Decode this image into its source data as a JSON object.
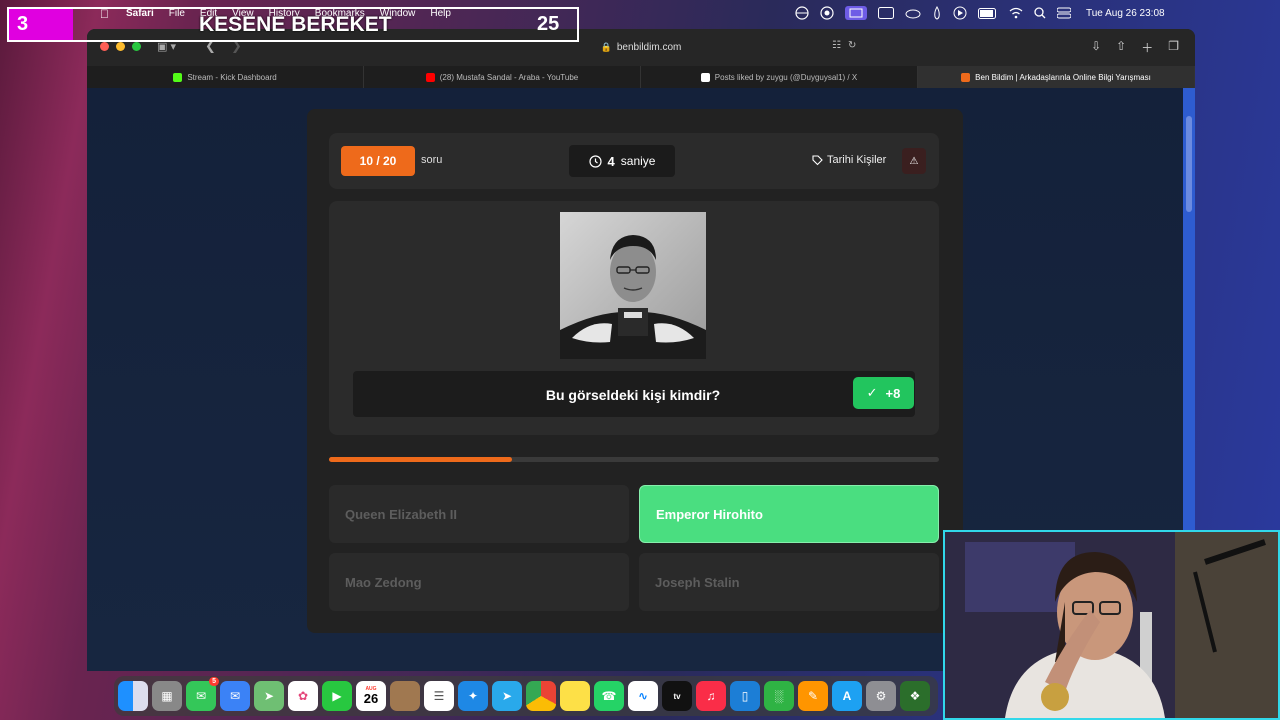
{
  "overlay": {
    "number": "3",
    "title": "KESENE BEREKET",
    "count": "25"
  },
  "menubar": {
    "app": "Safari",
    "menus": [
      "File",
      "Edit",
      "View",
      "History",
      "Bookmarks",
      "Window",
      "Help"
    ],
    "clock": "Tue Aug 26  23:08"
  },
  "browser": {
    "url": "benbildim.com",
    "tabs": [
      {
        "label": "Stream - Kick Dashboard",
        "icon": "kick-icon",
        "color": "#53fc18"
      },
      {
        "label": "(28) Mustafa Sandal - Araba - YouTube",
        "icon": "youtube-icon",
        "color": "#ff0000"
      },
      {
        "label": "Posts liked by zuygu (@Duyguysal1) / X",
        "icon": "x-icon",
        "color": "#ffffff"
      },
      {
        "label": "Ben Bildim | Arkadaşlarınla Online Bilgi Yarışması",
        "icon": "benbildim-icon",
        "color": "#ee6a1b"
      }
    ]
  },
  "quiz": {
    "question_counter": "10 / 20",
    "question_label": "soru",
    "timer_value": "4",
    "timer_unit": "saniye",
    "category": "Tarihi Kişiler",
    "question": "Bu görseldeki kişi kimdir?",
    "points": "+8",
    "progress": 0.3,
    "answers": [
      {
        "label": "Queen Elizabeth II",
        "state": "disabled"
      },
      {
        "label": "Emperor Hirohito",
        "state": "correct"
      },
      {
        "label": "Mao Zedong",
        "state": "disabled"
      },
      {
        "label": "Joseph Stalin",
        "state": "disabled"
      }
    ]
  },
  "dock": {
    "calendar_month": "AUG",
    "calendar_day": "26",
    "messages_badge": "5"
  },
  "colors": {
    "accent": "#ee6a1b",
    "correct": "#4ade80",
    "webcam_border": "#31d8ea",
    "overlay_magenta": "#e000e0"
  }
}
